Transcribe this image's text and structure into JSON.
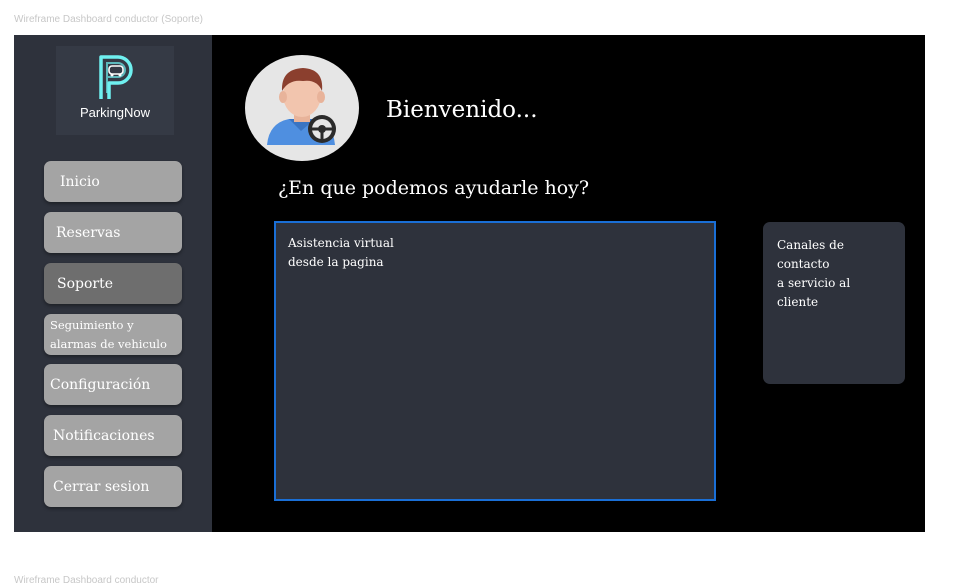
{
  "frame_labels": {
    "top": "Wireframe Dashboard conductor (Soporte)",
    "bottom": "Wireframe Dashboard conductor"
  },
  "logo": {
    "brand": "ParkingNow",
    "icon": "parking-car-logo-icon"
  },
  "sidebar": {
    "items": [
      {
        "label": "Inicio",
        "active": false
      },
      {
        "label": "Reservas",
        "active": false
      },
      {
        "label": "Soporte",
        "active": true
      },
      {
        "label_line1": "Seguimiento y",
        "label_line2": "alarmas de vehiculo",
        "active": false
      },
      {
        "label": "Configuración",
        "active": false
      },
      {
        "label": "Notificaciones",
        "active": false
      },
      {
        "label": "Cerrar sesion",
        "active": false
      }
    ]
  },
  "header": {
    "avatar_icon": "driver-avatar-icon",
    "welcome": "Bienvenido..."
  },
  "main": {
    "question": "¿En que podemos ayudarle hoy?",
    "assistant": {
      "line1": "Asistencia virtual",
      "line2": "desde la pagina"
    },
    "channels": {
      "line1": "Canales de contacto",
      "line2": "a servicio al cliente"
    }
  },
  "colors": {
    "frame_bg": "#000000",
    "sidebar_bg": "#2e323c",
    "nav_button": "#a4a4a4",
    "nav_active": "#6e6e6e",
    "panel_bg": "#2e323c",
    "selection_border": "#1a6fd6",
    "logo_accent": "#6ff0f0"
  }
}
